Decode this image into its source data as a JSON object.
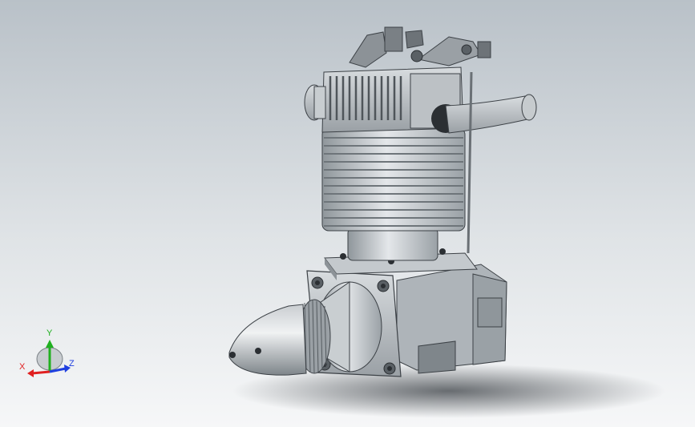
{
  "viewport": {
    "name": "engine-3d-model-view"
  },
  "triad": {
    "x_label": "X",
    "y_label": "Y",
    "z_label": "Z",
    "colors": {
      "x": "#e02020",
      "y": "#20b020",
      "z": "#2040e0"
    }
  },
  "icons": [
    "reference-triad-icon",
    "sphere-icon"
  ]
}
